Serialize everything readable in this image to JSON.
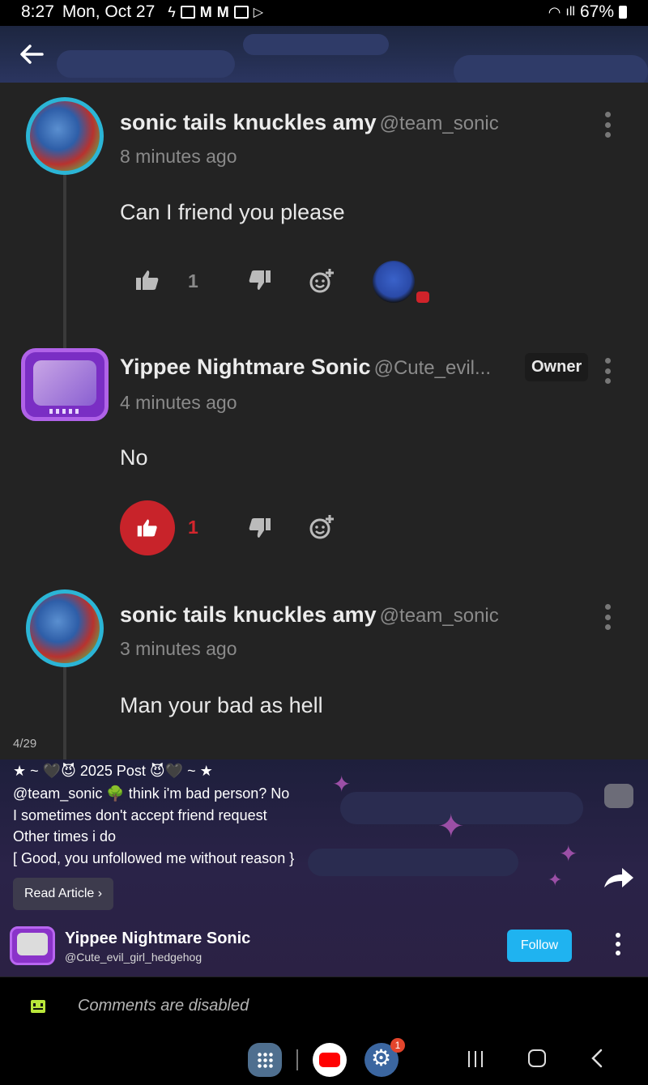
{
  "status_bar": {
    "time": "8:27",
    "date": "Mon, Oct 27",
    "battery": "67%"
  },
  "comments": [
    {
      "username": "sonic tails knuckles amy",
      "handle": "@team_sonic",
      "time": "8 minutes ago",
      "text": "Can I friend you please",
      "likes": "1",
      "has_reaction": true
    },
    {
      "username": "Yippee Nightmare Sonic",
      "handle": "@Cute_evil...",
      "badge": "Owner",
      "time": "4 minutes ago",
      "text": "No",
      "likes": "1",
      "liked": true
    },
    {
      "username": "sonic tails knuckles amy",
      "handle": "@team_sonic",
      "time": "3 minutes ago",
      "text": "Man your bad as hell"
    }
  ],
  "page_indicator": "4/29",
  "post": {
    "lines": [
      "★ ~ 🖤😈 2025 Post 😈🖤 ~ ★",
      "@team_sonic 🌳 think i'm bad person? No",
      "I sometimes don't accept friend request",
      "Other times i do",
      "[ Good, you unfollowed me without reason }"
    ],
    "read_article": "Read Article ›",
    "author_name": "Yippee Nightmare Sonic",
    "author_handle": "@Cute_evil_girl_hedgehog",
    "follow": "Follow"
  },
  "comments_disabled": "Comments are disabled",
  "nav": {
    "settings_badge": "1"
  },
  "colors": {
    "background": "#232323",
    "accent_like": "#c8232a",
    "follow": "#1fb3f0"
  }
}
